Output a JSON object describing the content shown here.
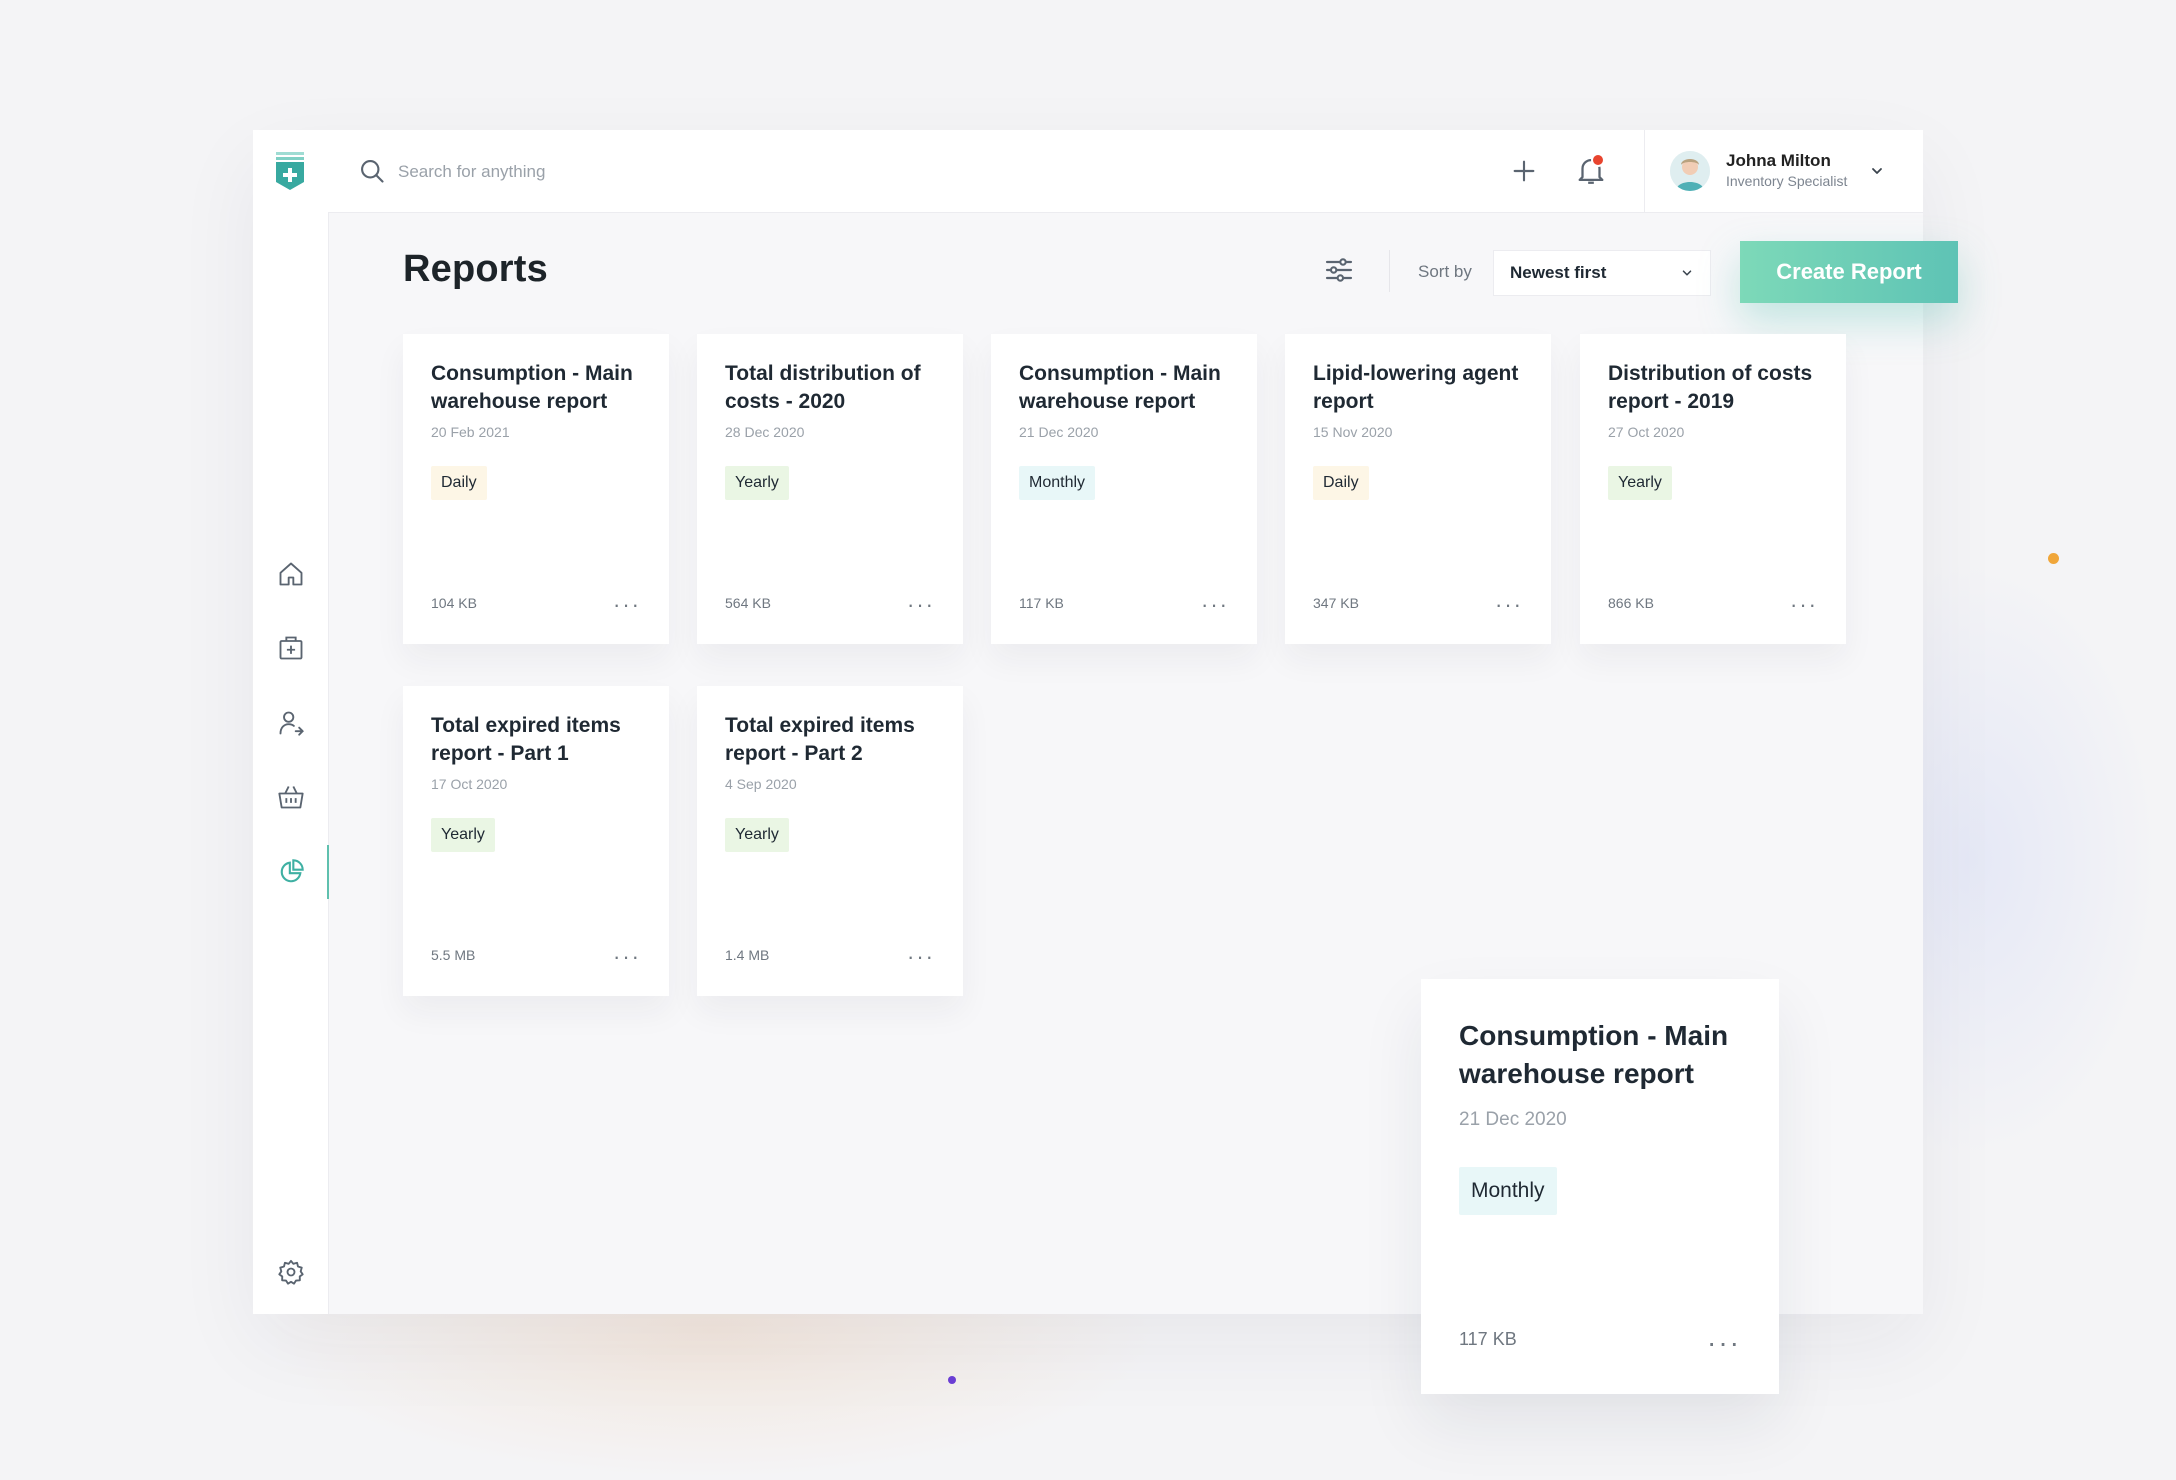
{
  "search": {
    "placeholder": "Search for anything"
  },
  "user": {
    "name": "Johna Milton",
    "role": "Inventory Specialist"
  },
  "page": {
    "title": "Reports"
  },
  "toolbar": {
    "sort_label": "Sort by",
    "sort_value": "Newest first",
    "create_label": "Create Report"
  },
  "sidebar": {
    "items": [
      {
        "icon": "home-icon"
      },
      {
        "icon": "medical-kit-icon"
      },
      {
        "icon": "user-transfer-icon"
      },
      {
        "icon": "basket-icon"
      },
      {
        "icon": "pie-chart-icon",
        "active": true
      },
      {
        "icon": "gear-icon"
      }
    ]
  },
  "reports": [
    {
      "title": "Consumption - Main warehouse report",
      "date": "20 Feb 2021",
      "frequency": "Daily",
      "size": "104 KB",
      "more": "···"
    },
    {
      "title": "Total distribution of costs - 2020",
      "date": "28 Dec 2020",
      "frequency": "Yearly",
      "size": "564 KB",
      "more": "···"
    },
    {
      "title": "Consumption - Main warehouse report",
      "date": "21 Dec 2020",
      "frequency": "Monthly",
      "size": "117 KB",
      "more": "···"
    },
    {
      "title": "Lipid-lowering agent report",
      "date": "15 Nov 2020",
      "frequency": "Daily",
      "size": "347 KB",
      "more": "···"
    },
    {
      "title": "Distribution of costs report - 2019",
      "date": "27 Oct 2020",
      "frequency": "Yearly",
      "size": "866 KB",
      "more": "···"
    },
    {
      "title": "Total expired items report - Part 1",
      "date": "17 Oct 2020",
      "frequency": "Yearly",
      "size": "5.5 MB",
      "more": "···"
    },
    {
      "title": "Total expired items report - Part 2",
      "date": "4 Sep 2020",
      "frequency": "Yearly",
      "size": "1.4 MB",
      "more": "···"
    }
  ],
  "featured": {
    "title": "Consumption - Main warehouse report",
    "date": "21 Dec 2020",
    "frequency": "Monthly",
    "size": "117 KB",
    "more": "···"
  },
  "colors": {
    "accent": "#5ec3b5",
    "notification": "#e8442e",
    "daily_bg": "#fdf6e6",
    "yearly_bg": "#eaf6e4",
    "monthly_bg": "#e8f7f8"
  }
}
